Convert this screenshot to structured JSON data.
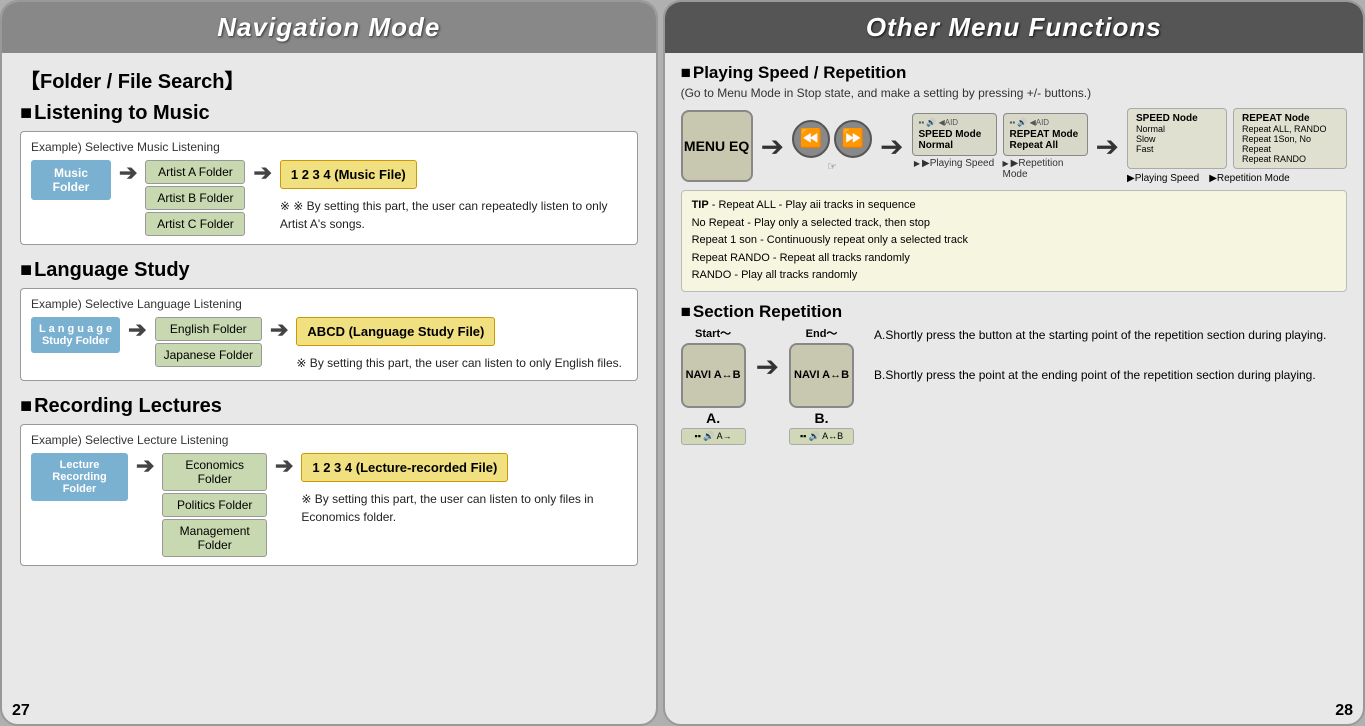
{
  "left": {
    "header": "Navigation Mode",
    "folder_file_search": "【Folder / File Search】",
    "listening_music": "Listening to Music",
    "example_music": "Example) Selective Music Listening",
    "music_folder": "Music Folder",
    "artist_a": "Artist A Folder",
    "artist_b": "Artist B Folder",
    "artist_c": "Artist C Folder",
    "music_file": "1  2  3  4  (Music File)",
    "music_note": "※ By setting this part, the user can repeatedly listen to only Artist A's songs.",
    "language_study": "Language Study",
    "example_language": "Example) Selective Language Listening",
    "language_study_folder": "L a n g u a g e\nStudy Folder",
    "english_folder": "English Folder",
    "japanese_folder": "Japanese Folder",
    "language_file": "ABCD  (Language Study File)",
    "language_note": "※ By setting this part, the user can listen to only English files.",
    "recording_lectures": "Recording Lectures",
    "example_lecture": "Example) Selective Lecture Listening",
    "lecture_recording_folder": "Lecture  Recording\nFolder",
    "economics_folder": "Economics Folder",
    "politics_folder": "Politics Folder",
    "management_folder": "Management Folder",
    "lecture_file": "1  2  3  4  (Lecture-recorded File)",
    "lecture_note": "※ By setting this part, the user can listen to only files in Economics folder.",
    "page_number": "27"
  },
  "right": {
    "header": "Other Menu Functions",
    "playing_speed_title": "Playing Speed / Repetition",
    "playing_speed_subtitle": "(Go to Menu Mode in Stop state, and make a setting by pressing +/- buttons.)",
    "menu_eq": "MENU\nEQ",
    "speed_mode_label": "▶Playing Speed",
    "repeat_mode_label": "▶Repetition Mode",
    "speed_mode_title": "SPEED Mode",
    "speed_mode_value": "Normal",
    "repeat_mode_title": "REPEAT Mode",
    "repeat_mode_value": "Repeat All",
    "settings_speed_title": "SPEED Node",
    "settings_speed_normal": "Normal",
    "settings_speed_slow": "Slow",
    "settings_speed_fast": "Fast",
    "settings_repeat_title": "REPEAT Node",
    "settings_repeat_1": "Repeat ALL, RANDO",
    "settings_repeat_2": "Repeat 1Son, No Repeat",
    "settings_repeat_3": "Repeat RANDO",
    "playing_speed_label2": "▶Playing Speed",
    "repetition_mode_label2": "▶Repetition Mode",
    "tip_label": "TIP",
    "tip_line1": "-  Repeat ALL - Play aii tracks in sequence",
    "tip_line2": "   No Repeat - Play only a selected track, then stop",
    "tip_line3": "   Repeat 1 son - Continuously repeat only a selected track",
    "tip_line4": "   Repeat RANDO - Repeat all tracks randomly",
    "tip_line5": "   RANDO - Play all tracks randomly",
    "section_repetition": "Section Repetition",
    "navi_ab": "NAVI\nA↔B",
    "start_label": "Start～",
    "end_label": "End～",
    "point_a_label": "A.",
    "point_b_label": "B.",
    "rep_text_a": "A.Shortly press the button at the starting point of the repetition section during playing.",
    "rep_text_b": "B.Shortly press the point at the ending point of the repetition section during playing.",
    "page_number": "28"
  }
}
